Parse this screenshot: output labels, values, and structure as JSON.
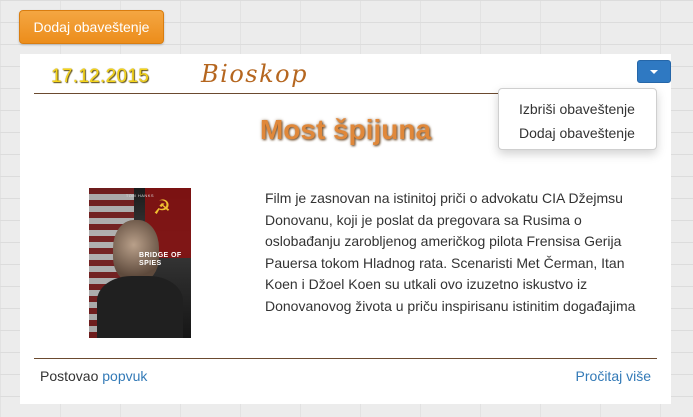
{
  "toolbar": {
    "add_notice_label": "Dodaj obaveštenje"
  },
  "notice": {
    "date": "17.12.2015",
    "category": "Bioskop",
    "title": "Most špijuna",
    "description": "Film je zasnovan na istinitoj priči o advokatu CIA Džejmsu Donovanu, koji je poslat da pregovara sa Rusima o oslobađanju zarobljenog američkog pilota Frensisa Gerija Pauersa tokom Hladnog rata. Scenaristi Met Čerman, Itan Koen i Džoel Koen su utkali ovo izuzetno iskustvo iz Donovanovog života u priču inspirisanu istinitim događajima",
    "poster": {
      "title_text": "BRIDGE OF SPIES",
      "credit_text": "TOM HANKS"
    },
    "posted_by_prefix": "Postovao",
    "author": "popvuk",
    "read_more_label": "Pročitaj više"
  },
  "dropdown": {
    "expanded": true,
    "items": [
      {
        "label": "Izbriši obaveštenje"
      },
      {
        "label": "Dodaj obaveštenje"
      }
    ]
  },
  "colors": {
    "accent_orange": "#ec8d1b",
    "date_yellow": "#f5d41a",
    "category_brown": "#b5661f",
    "title_orange": "#e0883a",
    "link_blue": "#337ab7",
    "toggle_blue": "#2f79c2",
    "divider_brown": "#6b4a2f"
  },
  "icons": {
    "dropdown_toggle": "caret-down-icon"
  }
}
